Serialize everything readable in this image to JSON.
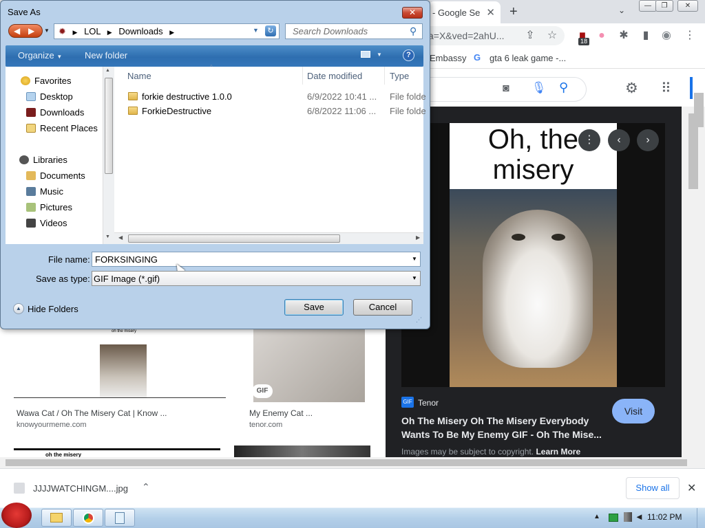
{
  "browser": {
    "tab_title": "- Google Se",
    "omnibox_text": "a=X&ved=2ahU...",
    "extension_badge": "18",
    "bookmarks": [
      "Embassy",
      "gta 6 leak game -..."
    ]
  },
  "results": [
    {
      "title": "Wawa Cat / Oh The Misery Cat | Know ...",
      "source": "knowyourmeme.com",
      "thumb_caption": "oh the misery"
    },
    {
      "title": "My Enemy Cat ...",
      "source": "tenor.com",
      "badge": "GIF"
    }
  ],
  "bottom_row_caption": "oh the misery",
  "preview": {
    "caption": "Oh, the misery",
    "source_badge": "GIF",
    "source_name": "Tenor",
    "title": "Oh The Misery Oh The Misery Everybody Wants To Be My Enemy GIF - Oh The Mise...",
    "visit_label": "Visit",
    "copyright": "Images may be subject to copyright.",
    "learn_more": "Learn More"
  },
  "downloads": {
    "file": "JJJJWATCHINGM....jpg",
    "show_all": "Show all"
  },
  "taskbar": {
    "clock": "11:02 PM"
  },
  "dialog": {
    "title": "Save As",
    "breadcrumb": [
      "LOL",
      "Downloads"
    ],
    "search_placeholder": "Search Downloads",
    "organize": "Organize",
    "new_folder": "New folder",
    "nav": {
      "favorites": "Favorites",
      "favorites_items": [
        "Desktop",
        "Downloads",
        "Recent Places"
      ],
      "libraries": "Libraries",
      "libraries_items": [
        "Documents",
        "Music",
        "Pictures",
        "Videos"
      ]
    },
    "columns": {
      "name": "Name",
      "date": "Date modified",
      "type": "Type"
    },
    "files": [
      {
        "name": "forkie destructive 1.0.0",
        "date": "6/9/2022 10:41 ...",
        "type": "File folde"
      },
      {
        "name": "ForkieDestructive",
        "date": "6/8/2022 11:06 ...",
        "type": "File folde"
      }
    ],
    "file_name_label": "File name:",
    "file_name_value": "FORKSINGING",
    "save_type_label": "Save as type:",
    "save_type_value": "GIF Image (*.gif)",
    "hide_folders": "Hide Folders",
    "save": "Save",
    "cancel": "Cancel"
  }
}
